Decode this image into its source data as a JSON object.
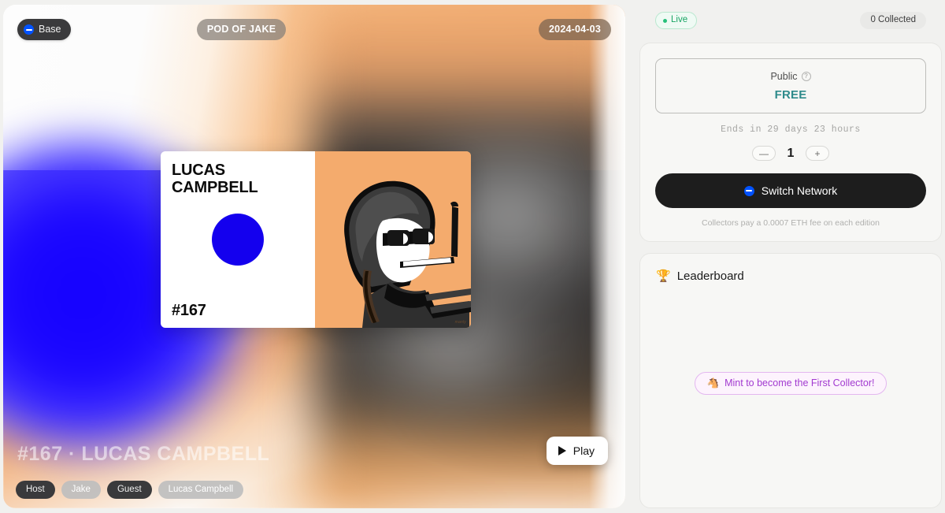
{
  "hero": {
    "chain_pill": {
      "label": "Base",
      "icon": "base-logo-icon",
      "color": "#0052ff"
    },
    "center_pill": {
      "label": "POD OF JAKE"
    },
    "date_pill": {
      "label": "2024-04-03"
    },
    "ghost_title": "#167 · LUCAS CAMPBELL",
    "card": {
      "name": "LUCAS\nCAMPBELL",
      "name_line1": "LUCAS",
      "name_line2": "CAMPBELL",
      "edition_number": "#167",
      "circle_color": "#1400ee",
      "art_bg_color": "#f4ab6d",
      "signature": "manly"
    },
    "play_button": {
      "label": "Play",
      "icon": "play-icon"
    },
    "tags": [
      {
        "label": "Host",
        "style": "dark"
      },
      {
        "label": "Jake",
        "style": "light"
      },
      {
        "label": "Guest",
        "style": "dark"
      },
      {
        "label": "Lucas Campbell",
        "style": "light"
      }
    ]
  },
  "sidebar": {
    "status": {
      "label": "Live",
      "color": "#1aa564"
    },
    "collected": {
      "label": "0 Collected"
    },
    "mint_panel": {
      "sale_type": "Public",
      "help_icon": "question-mark-circle-icon",
      "price": "FREE",
      "price_color": "#2e8b8b",
      "ends_in": "Ends in 29 days 23 hours",
      "quantity": {
        "decrement_label": "—",
        "value": "1",
        "increment_label": "+"
      },
      "action_button": {
        "label": "Switch Network",
        "icon": "base-logo-icon"
      },
      "fee_note": "Collectors pay a 0.0007 ETH fee on each edition"
    },
    "leaderboard": {
      "icon": "trophy-icon",
      "title": "Leaderboard",
      "empty_cta": {
        "icon": "horse-icon",
        "label": "Mint to become the First Collector!"
      }
    }
  }
}
